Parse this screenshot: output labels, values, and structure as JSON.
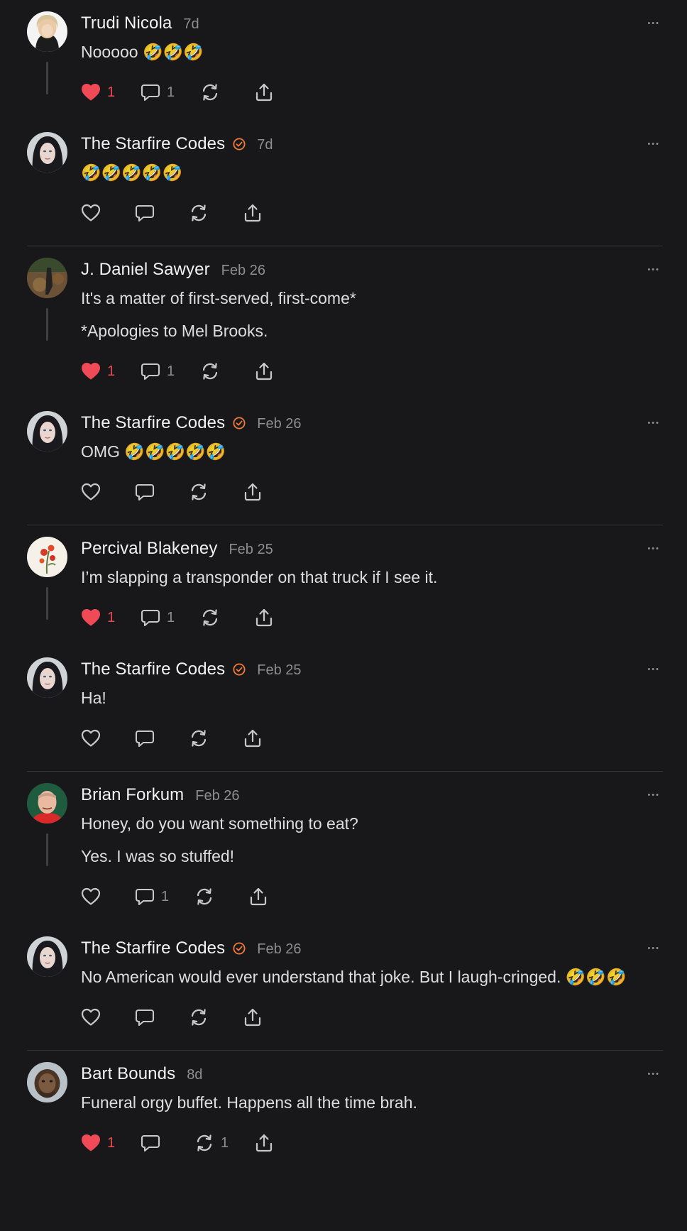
{
  "colors": {
    "background": "#18181a",
    "heart_liked": "#ef4a56",
    "verified": "#f27b35",
    "text": "#e6e6e8",
    "muted": "#8d8d92"
  },
  "threads": [
    {
      "posts": [
        {
          "author": "Trudi Nicola",
          "date": "7d",
          "verified": false,
          "avatar": "avatar-trudi",
          "paragraphs": [
            "Nooooo 🤣🤣🤣"
          ],
          "liked": true,
          "likes": "1",
          "replies": "1",
          "reposts": ""
        },
        {
          "author": "The Starfire Codes",
          "date": "7d",
          "verified": true,
          "avatar": "avatar-starfire",
          "paragraphs": [
            "🤣🤣🤣🤣🤣"
          ],
          "liked": false,
          "likes": "",
          "replies": "",
          "reposts": ""
        }
      ]
    },
    {
      "posts": [
        {
          "author": "J. Daniel Sawyer",
          "date": "Feb 26",
          "verified": false,
          "avatar": "avatar-sawyer",
          "paragraphs": [
            "It's a matter of first-served, first-come*",
            "*Apologies to Mel Brooks."
          ],
          "liked": true,
          "likes": "1",
          "replies": "1",
          "reposts": ""
        },
        {
          "author": "The Starfire Codes",
          "date": "Feb 26",
          "verified": true,
          "avatar": "avatar-starfire",
          "paragraphs": [
            "OMG 🤣🤣🤣🤣🤣"
          ],
          "liked": false,
          "likes": "",
          "replies": "",
          "reposts": ""
        }
      ]
    },
    {
      "posts": [
        {
          "author": "Percival Blakeney",
          "date": "Feb 25",
          "verified": false,
          "avatar": "avatar-percival",
          "paragraphs": [
            "I’m slapping a transponder on that truck if I see it."
          ],
          "liked": true,
          "likes": "1",
          "replies": "1",
          "reposts": ""
        },
        {
          "author": "The Starfire Codes",
          "date": "Feb 25",
          "verified": true,
          "avatar": "avatar-starfire",
          "paragraphs": [
            "Ha!"
          ],
          "liked": false,
          "likes": "",
          "replies": "",
          "reposts": ""
        }
      ]
    },
    {
      "posts": [
        {
          "author": "Brian Forkum",
          "date": "Feb 26",
          "verified": false,
          "avatar": "avatar-brian",
          "paragraphs": [
            "Honey, do you want something to eat?",
            "Yes. I was so stuffed!"
          ],
          "liked": false,
          "likes": "",
          "replies": "1",
          "reposts": ""
        },
        {
          "author": "The Starfire Codes",
          "date": "Feb 26",
          "verified": true,
          "avatar": "avatar-starfire",
          "paragraphs": [
            "No American would ever understand that joke. But I laugh-cringed. 🤣🤣🤣"
          ],
          "liked": false,
          "likes": "",
          "replies": "",
          "reposts": ""
        }
      ]
    },
    {
      "posts": [
        {
          "author": "Bart Bounds",
          "date": "8d",
          "verified": false,
          "avatar": "avatar-bart",
          "paragraphs": [
            "Funeral orgy buffet. Happens all the time brah."
          ],
          "liked": true,
          "likes": "1",
          "replies": "",
          "reposts": "1"
        }
      ]
    }
  ]
}
